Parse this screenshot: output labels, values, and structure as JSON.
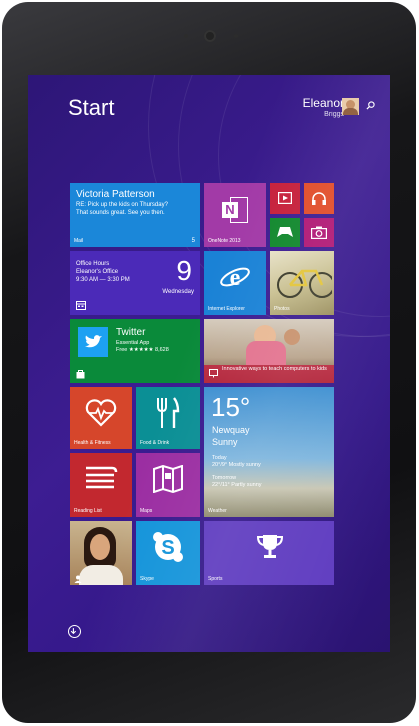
{
  "start_label": "Start",
  "user": {
    "first": "Eleanor",
    "last": "Briggs"
  },
  "mail": {
    "sender": "Victoria Patterson",
    "subject": "RE: Pick up the kids on Thursday?",
    "preview": "That sounds great. See you then.",
    "label": "Mail",
    "count": "5"
  },
  "calendar": {
    "title": "Office Hours",
    "location": "Eleanor's Office",
    "time": "9:30 AM — 3:30 PM",
    "day_num": "9",
    "day_name": "Wednesday"
  },
  "onenote": {
    "label": "OneNote 2013"
  },
  "ie": {
    "label": "Internet Explorer"
  },
  "photos": {
    "label": "Photos"
  },
  "twitter": {
    "title": "Twitter",
    "sub": "Essential App",
    "price": "Free ★★★★★ 8,628"
  },
  "store_promo": {
    "text": "Innovative ways to teach computers to kids"
  },
  "health": {
    "label": "Health & Fitness"
  },
  "food": {
    "label": "Food & Drink"
  },
  "weather": {
    "temp": "15°",
    "city": "Newquay",
    "condition": "Sunny",
    "today_label": "Today",
    "today": "20°/9° Mostly sunny",
    "tomorrow_label": "Tomorrow",
    "tomorrow": "22°/11° Partly sunny",
    "label": "Weather"
  },
  "reading": {
    "label": "Reading List"
  },
  "maps": {
    "label": "Maps"
  },
  "skype": {
    "label": "Skype"
  },
  "sports": {
    "label": "Sports"
  },
  "colors": {
    "mail": "#1b87d9",
    "calendar": "#4b2ab8",
    "onenote": "#a23aa7",
    "video": "#c6203b",
    "music": "#e14d2a",
    "xbox": "#11882d",
    "camera": "#b01875",
    "ie": "#1a82d6",
    "twitter": "#0a8a3a",
    "health": "#d6462b",
    "food": "#0b8f95",
    "weather": "#2c9ad9",
    "reading": "#c2282f",
    "maps": "#9b2ea2",
    "skype": "#1494da",
    "sports": "#5f3cc0"
  }
}
